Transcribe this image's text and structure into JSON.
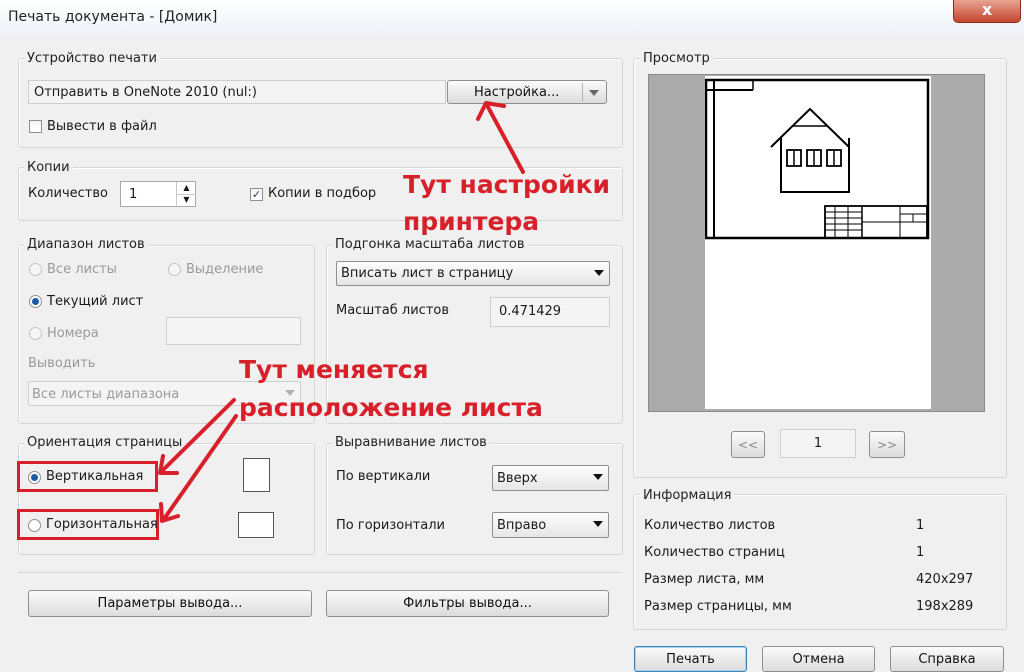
{
  "window": {
    "title": "Печать документа - [Домик]",
    "close_glyph": "x"
  },
  "printer_group": {
    "label": "Устройство печати",
    "printer_value": "Отправить в OneNote 2010 (nul:)",
    "setup_button": "Настройка...",
    "print_to_file": {
      "label": "Вывести в файл",
      "checked": false
    }
  },
  "copies_group": {
    "label": "Копии",
    "quantity_label": "Количество",
    "quantity_value": "1",
    "collate": {
      "label": "Копии в подбор",
      "checked": true
    }
  },
  "range_group": {
    "label": "Диапазон листов",
    "all_sheets": "Все листы",
    "selection": "Выделение",
    "current_sheet": "Текущий лист",
    "numbers": "Номера",
    "output_label": "Выводить",
    "output_value": "Все листы диапазона",
    "selected": "current_sheet"
  },
  "scale_group": {
    "label": "Подгонка масштаба листов",
    "fit_value": "Вписать лист в страницу",
    "scale_label": "Масштаб листов",
    "scale_value": "0.471429"
  },
  "orientation_group": {
    "label": "Ориентация страницы",
    "portrait": "Вертикальная",
    "landscape": "Горизонтальная",
    "selected": "portrait"
  },
  "align_group": {
    "label": "Выравнивание листов",
    "vertical_label": "По вертикали",
    "vertical_value": "Вверх",
    "horizontal_label": "По горизонтали",
    "horizontal_value": "Вправо"
  },
  "bottom_buttons": {
    "output_params": "Параметры вывода...",
    "output_filters": "Фильтры вывода...",
    "print": "Печать",
    "cancel": "Отмена",
    "help": "Справка"
  },
  "preview_group": {
    "label": "Просмотр",
    "prev": "<<",
    "page": "1",
    "next": ">>"
  },
  "info_group": {
    "label": "Информация",
    "rows": [
      {
        "label": "Количество листов",
        "value": "1"
      },
      {
        "label": "Количество страниц",
        "value": "1"
      },
      {
        "label": "Размер листа, мм",
        "value": "420x297"
      },
      {
        "label": "Размер страницы, мм",
        "value": "198x289"
      }
    ]
  },
  "annotations": {
    "printer_note_line1": "Тут настройки",
    "printer_note_line2": "принтера",
    "orientation_note_line1": "Тут меняется",
    "orientation_note_line2": "расположение листа",
    "accent_color": "#d8202a"
  }
}
